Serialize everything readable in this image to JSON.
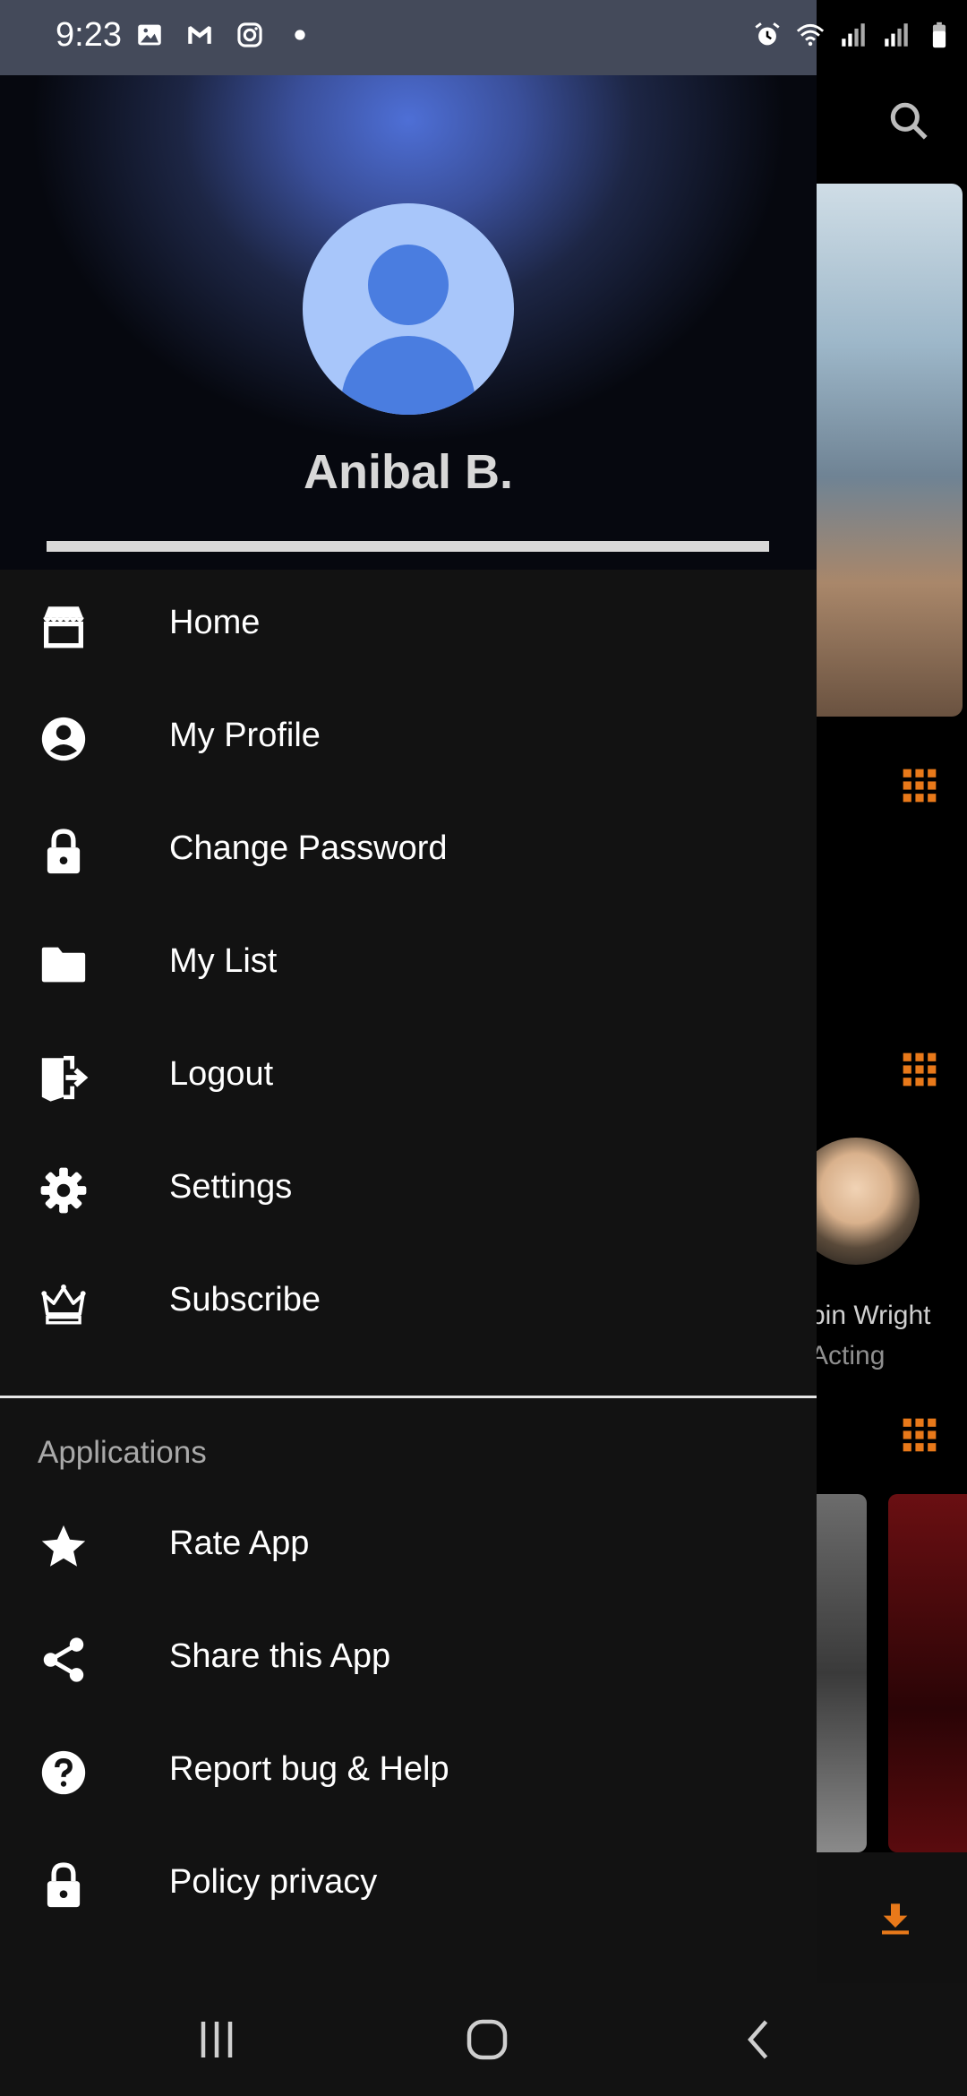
{
  "status_bar": {
    "time": "9:23",
    "left_icons": [
      "gallery-icon",
      "gmail-icon",
      "instagram-icon",
      "dot-icon"
    ],
    "right_icons": [
      "alarm-icon",
      "wifi-icon",
      "signal-icon",
      "signal-icon",
      "battery-icon"
    ]
  },
  "drawer": {
    "user_name": "Anibal B.",
    "avatar_icon": "account-icon",
    "menu_items": [
      {
        "label": "Home",
        "icon": "store-icon"
      },
      {
        "label": "My Profile",
        "icon": "account-circle-icon"
      },
      {
        "label": "Change Password",
        "icon": "lock-icon"
      },
      {
        "label": "My List",
        "icon": "folder-icon"
      },
      {
        "label": "Logout",
        "icon": "logout-icon"
      },
      {
        "label": "Settings",
        "icon": "gear-icon"
      },
      {
        "label": "Subscribe",
        "icon": "crown-icon"
      }
    ],
    "section_header": "Applications",
    "app_items": [
      {
        "label": "Rate App",
        "icon": "star-icon"
      },
      {
        "label": "Share this App",
        "icon": "share-icon"
      },
      {
        "label": "Report bug & Help",
        "icon": "help-icon"
      },
      {
        "label": "Policy privacy",
        "icon": "lock-icon"
      }
    ]
  },
  "background": {
    "person_name": "bin Wright",
    "person_role": "Acting",
    "accent_color": "#e8791a"
  },
  "navbar": {
    "buttons": [
      "recents-icon",
      "home-icon",
      "back-icon"
    ]
  },
  "colors": {
    "drawer_bg": "#121212",
    "avatar_bg": "#a8c6fa",
    "avatar_fg": "#4a7de0"
  }
}
